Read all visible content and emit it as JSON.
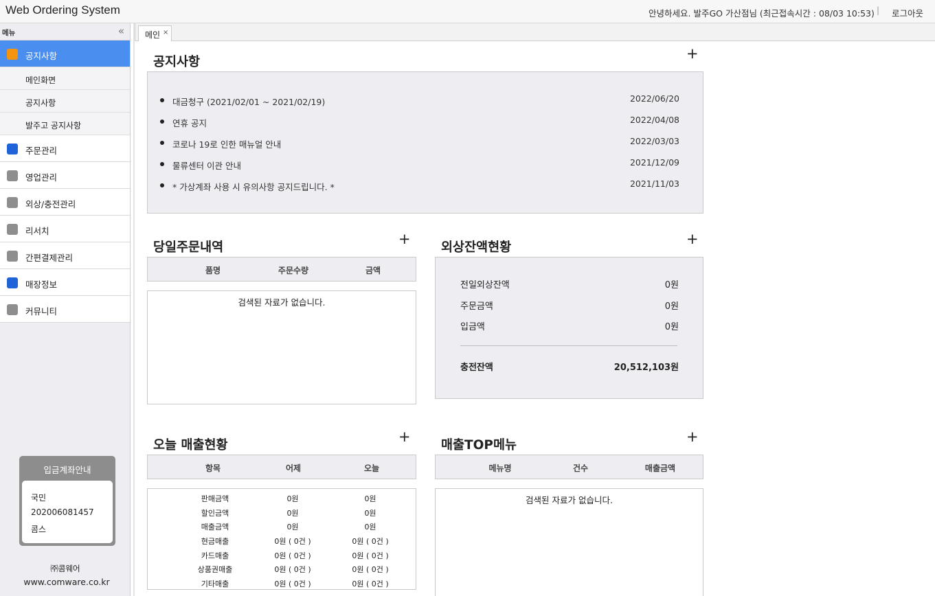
{
  "header": {
    "app_title": "Web Ordering System",
    "greeting": "안녕하세요. 발주GO 가산점님 (최근접속시간 : 08/03 10:53)",
    "separator": "|",
    "logout_label": "로그아웃"
  },
  "sidebar": {
    "title": "메뉴",
    "collapse_glyph": "«",
    "items": [
      {
        "label": "공지사항",
        "icon_color": "#f5940f",
        "active": true,
        "sub": [
          "메인화면",
          "공지사항",
          "발주고 공지사항"
        ]
      },
      {
        "label": "주문관리",
        "icon_color": "#1f63d8"
      },
      {
        "label": "영업관리",
        "icon_color": "#8e8e8e"
      },
      {
        "label": "외상/충전관리",
        "icon_color": "#8e8e8e"
      },
      {
        "label": "리서치",
        "icon_color": "#8e8e8e"
      },
      {
        "label": "간편결제관리",
        "icon_color": "#8e8e8e"
      },
      {
        "label": "매장정보",
        "icon_color": "#1f63d8"
      },
      {
        "label": "커뮤니티",
        "icon_color": "#8e8e8e"
      }
    ],
    "account": {
      "title": "입금계좌안내",
      "bank": "국민",
      "number": "202006081457",
      "holder": "콤스"
    },
    "company": "㈜콤웨어",
    "company_url": "www.comware.co.kr"
  },
  "tabs": [
    {
      "label": "메인",
      "close": "×"
    }
  ],
  "main": {
    "plus_glyph": "+",
    "notice": {
      "title": "공지사항",
      "items": [
        {
          "title": "대금청구 (2021/02/01 ~ 2021/02/19)",
          "date": "2022/06/20"
        },
        {
          "title": "연휴 공지",
          "date": "2022/04/08"
        },
        {
          "title": "코로나 19로 인한 매뉴얼 안내",
          "date": "2022/03/03"
        },
        {
          "title": "물류센터 이관 안내",
          "date": "2021/12/09"
        },
        {
          "title": "* 가상계좌 사용 시 유의사항 공지드립니다. *",
          "date": "2021/11/03"
        }
      ]
    },
    "today_orders": {
      "title": "당일주문내역",
      "columns": [
        "품명",
        "주문수량",
        "금액"
      ],
      "empty": "검색된 자료가 없습니다."
    },
    "credit_balance": {
      "title": "외상잔액현황",
      "rows": [
        {
          "label": "전일외상잔액",
          "value": "0원"
        },
        {
          "label": "주문금액",
          "value": "0원"
        },
        {
          "label": "입금액",
          "value": "0원"
        }
      ],
      "total_label": "충전잔액",
      "total_value": "20,512,103원"
    },
    "today_sales": {
      "title": "오늘 매출현황",
      "columns": [
        "항목",
        "어제",
        "오늘"
      ],
      "rows": [
        {
          "item": "판매금액",
          "yesterday": "0원",
          "today": "0원"
        },
        {
          "item": "할인금액",
          "yesterday": "0원",
          "today": "0원"
        },
        {
          "item": "매출금액",
          "yesterday": "0원",
          "today": "0원"
        },
        {
          "item": "현금매출",
          "yesterday": "0원 ( 0건 )",
          "today": "0원 ( 0건 )"
        },
        {
          "item": "카드매출",
          "yesterday": "0원 ( 0건 )",
          "today": "0원 ( 0건 )"
        },
        {
          "item": "상품권매출",
          "yesterday": "0원 ( 0건 )",
          "today": "0원 ( 0건 )"
        },
        {
          "item": "기타매출",
          "yesterday": "0원 ( 0건 )",
          "today": "0원 ( 0건 )"
        }
      ]
    },
    "top_menu": {
      "title": "매출TOP메뉴",
      "columns": [
        "메뉴명",
        "건수",
        "매출금액"
      ],
      "empty": "검색된 자료가 없습니다."
    }
  }
}
